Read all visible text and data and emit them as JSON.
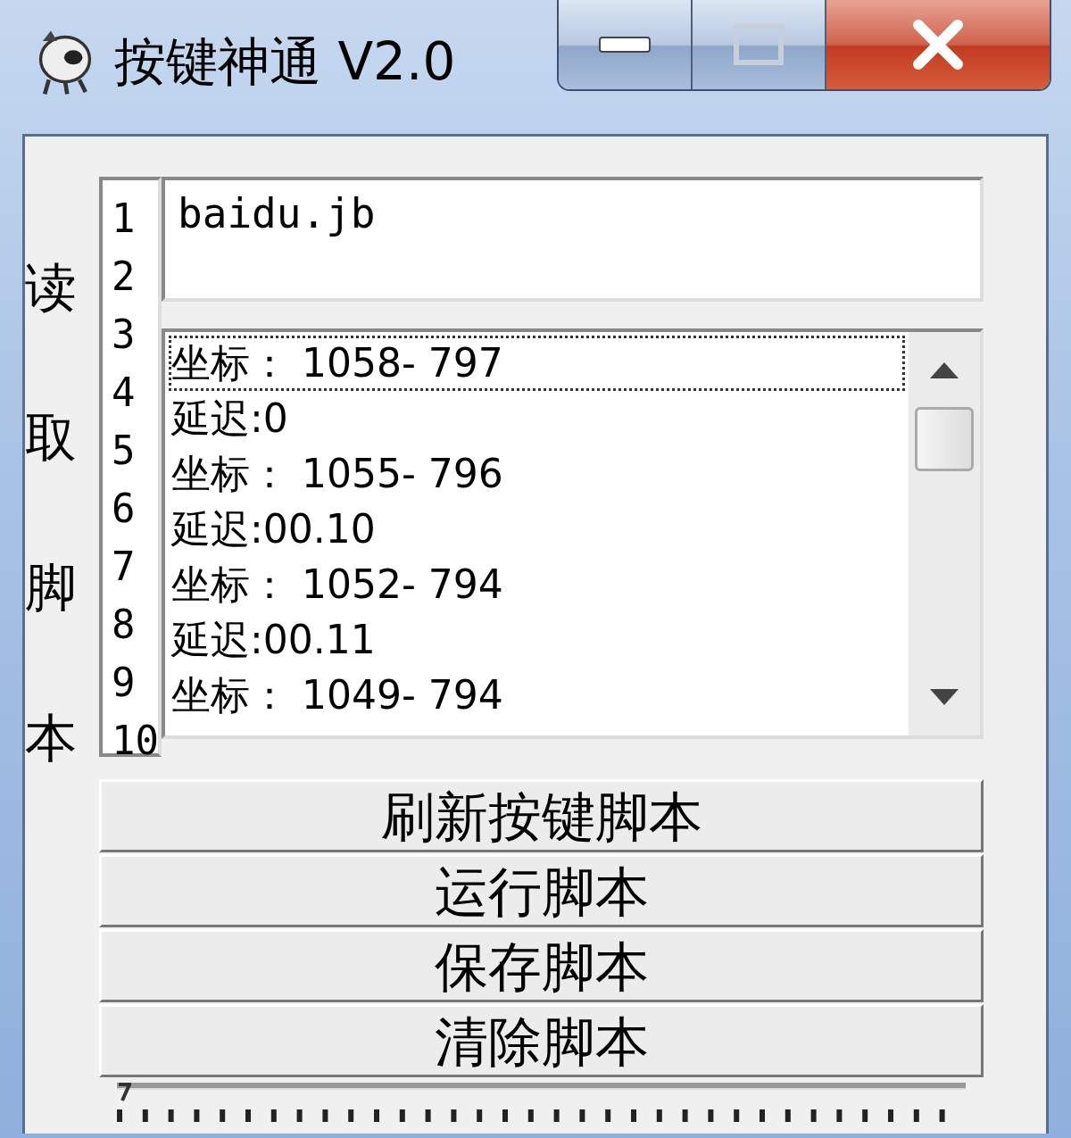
{
  "window": {
    "title": "按键神通 V2.0"
  },
  "side_label": "读取脚本",
  "line_numbers": [
    "1",
    "2",
    "3",
    "4",
    "5",
    "6",
    "7",
    "8",
    "9",
    "10"
  ],
  "file_field": {
    "value": "baidu.jb"
  },
  "script_list": [
    {
      "text": "坐标： 1058- 797",
      "focused": true
    },
    {
      "text": "延迟:0",
      "focused": false
    },
    {
      "text": "坐标： 1055- 796",
      "focused": false
    },
    {
      "text": "延迟:00.10",
      "focused": false
    },
    {
      "text": "坐标： 1052- 794",
      "focused": false
    },
    {
      "text": "延迟:00.11",
      "focused": false
    },
    {
      "text": "坐标： 1049- 794",
      "focused": false
    }
  ],
  "buttons": [
    "刷新按键脚本",
    "运行脚本",
    "保存脚本",
    "清除脚本"
  ],
  "slider": {
    "level": 0
  }
}
